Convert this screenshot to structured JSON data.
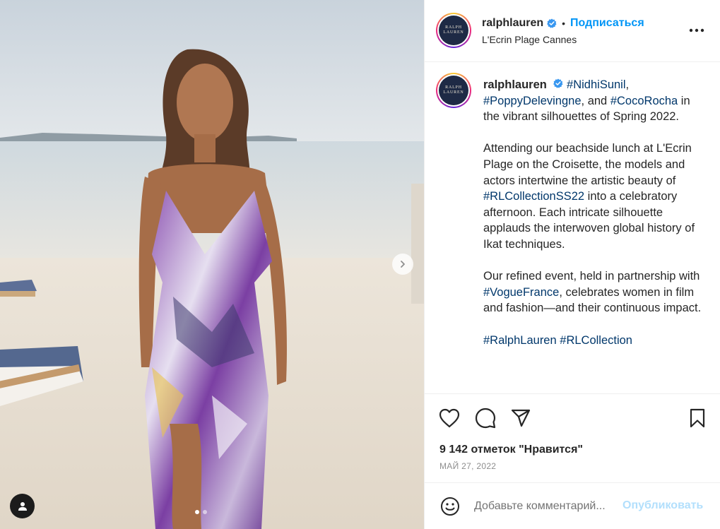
{
  "post": {
    "username": "ralphlauren",
    "separator": "•",
    "follow_label": "Подписаться",
    "location": "L'Ecrin Plage Cannes",
    "avatar_logo": {
      "line1": "RALPH",
      "line2": "LAUREN"
    }
  },
  "caption": {
    "username": "ralphlauren",
    "tag_nidhi": "#NidhiSunil",
    "comma1": ",",
    "tag_poppy": "#PoppyDelevingne",
    "and": ", and ",
    "tag_coco": "#CocoRocha",
    "line1_rest": " in the vibrant silhouettes of Spring 2022.",
    "para2_start": "Attending our beachside lunch at L'Ecrin Plage on the Croisette, the models and actors intertwine the artistic beauty of ",
    "tag_rlss22": "#RLCollectionSS22",
    "para2_end": " into a celebratory afternoon. Each intricate silhouette applauds the interwoven global history of Ikat techniques.",
    "para3_start": "Our refined event, held in partnership with ",
    "tag_vogue": "#VogueFrance",
    "para3_end": ", celebrates women in film and fashion—and their continuous impact.",
    "tag_rl": "#RalphLauren",
    "tag_rlc": "#RLCollection"
  },
  "engagement": {
    "likes_text": "9 142 отметок \"Нравится\"",
    "date": "МАЙ 27, 2022"
  },
  "comment": {
    "placeholder": "Добавьте комментарий...",
    "publish_label": "Опубликовать"
  },
  "carousel": {
    "total_slides": 2,
    "active_slide": 1
  },
  "colors": {
    "accent": "#0095f6",
    "hashtag": "#00376b",
    "publish_disabled": "#b2dffc",
    "verified": "#3897f0"
  },
  "icons": [
    "verified-icon",
    "more-icon",
    "heart-icon",
    "comment-icon",
    "share-icon",
    "bookmark-icon",
    "emoji-icon",
    "chevron-right-icon",
    "user-tag-icon"
  ]
}
